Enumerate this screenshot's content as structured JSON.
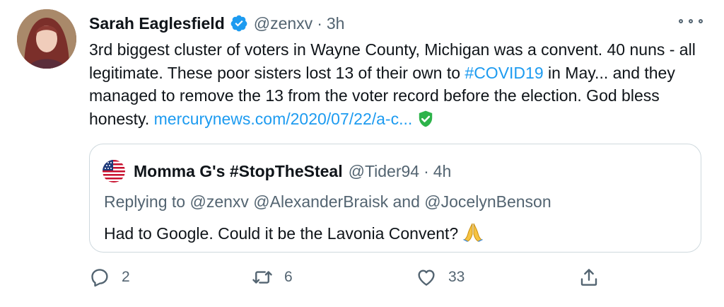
{
  "tweet": {
    "author_name": "Sarah Eaglesfield",
    "handle": "@zenxv",
    "dot": "·",
    "time": "3h",
    "text_part1": "3rd biggest cluster of voters in Wayne County, Michigan was a convent.  40 nuns - all legitimate.  These poor sisters lost 13 of their own to ",
    "hashtag": "#COVID19",
    "text_part2": " in May... and they managed to remove the 13 from the voter record before the election. God bless honesty. ",
    "link_text": "mercurynews.com/2020/07/22/a-c...",
    "icons": {
      "verified": "verified-badge-icon",
      "more": "more-icon",
      "shield": "shield-check-icon"
    }
  },
  "quoted": {
    "author_name": "Momma G's #StopTheSteal",
    "handle": "@Tider94",
    "dot": "·",
    "time": "4h",
    "reply_prefix": "Replying to ",
    "reply_user1": "@zenxv",
    "reply_user2": "@AlexanderBraisk",
    "reply_and": " and ",
    "reply_user3": "@JocelynBenson",
    "text": "Had to Google. Could it be the Lavonia Convent?",
    "icons": {
      "avatar": "us-flag-icon",
      "emoji": "folded-hands-icon"
    }
  },
  "actions": {
    "reply_count": "2",
    "retweet_count": "6",
    "like_count": "33",
    "icons": [
      "reply-icon",
      "retweet-icon",
      "like-icon",
      "share-icon"
    ]
  },
  "colors": {
    "link": "#1d9bf0",
    "muted": "#536471",
    "text": "#0f1419",
    "border": "#cfd9de",
    "shield": "#2db34a"
  }
}
